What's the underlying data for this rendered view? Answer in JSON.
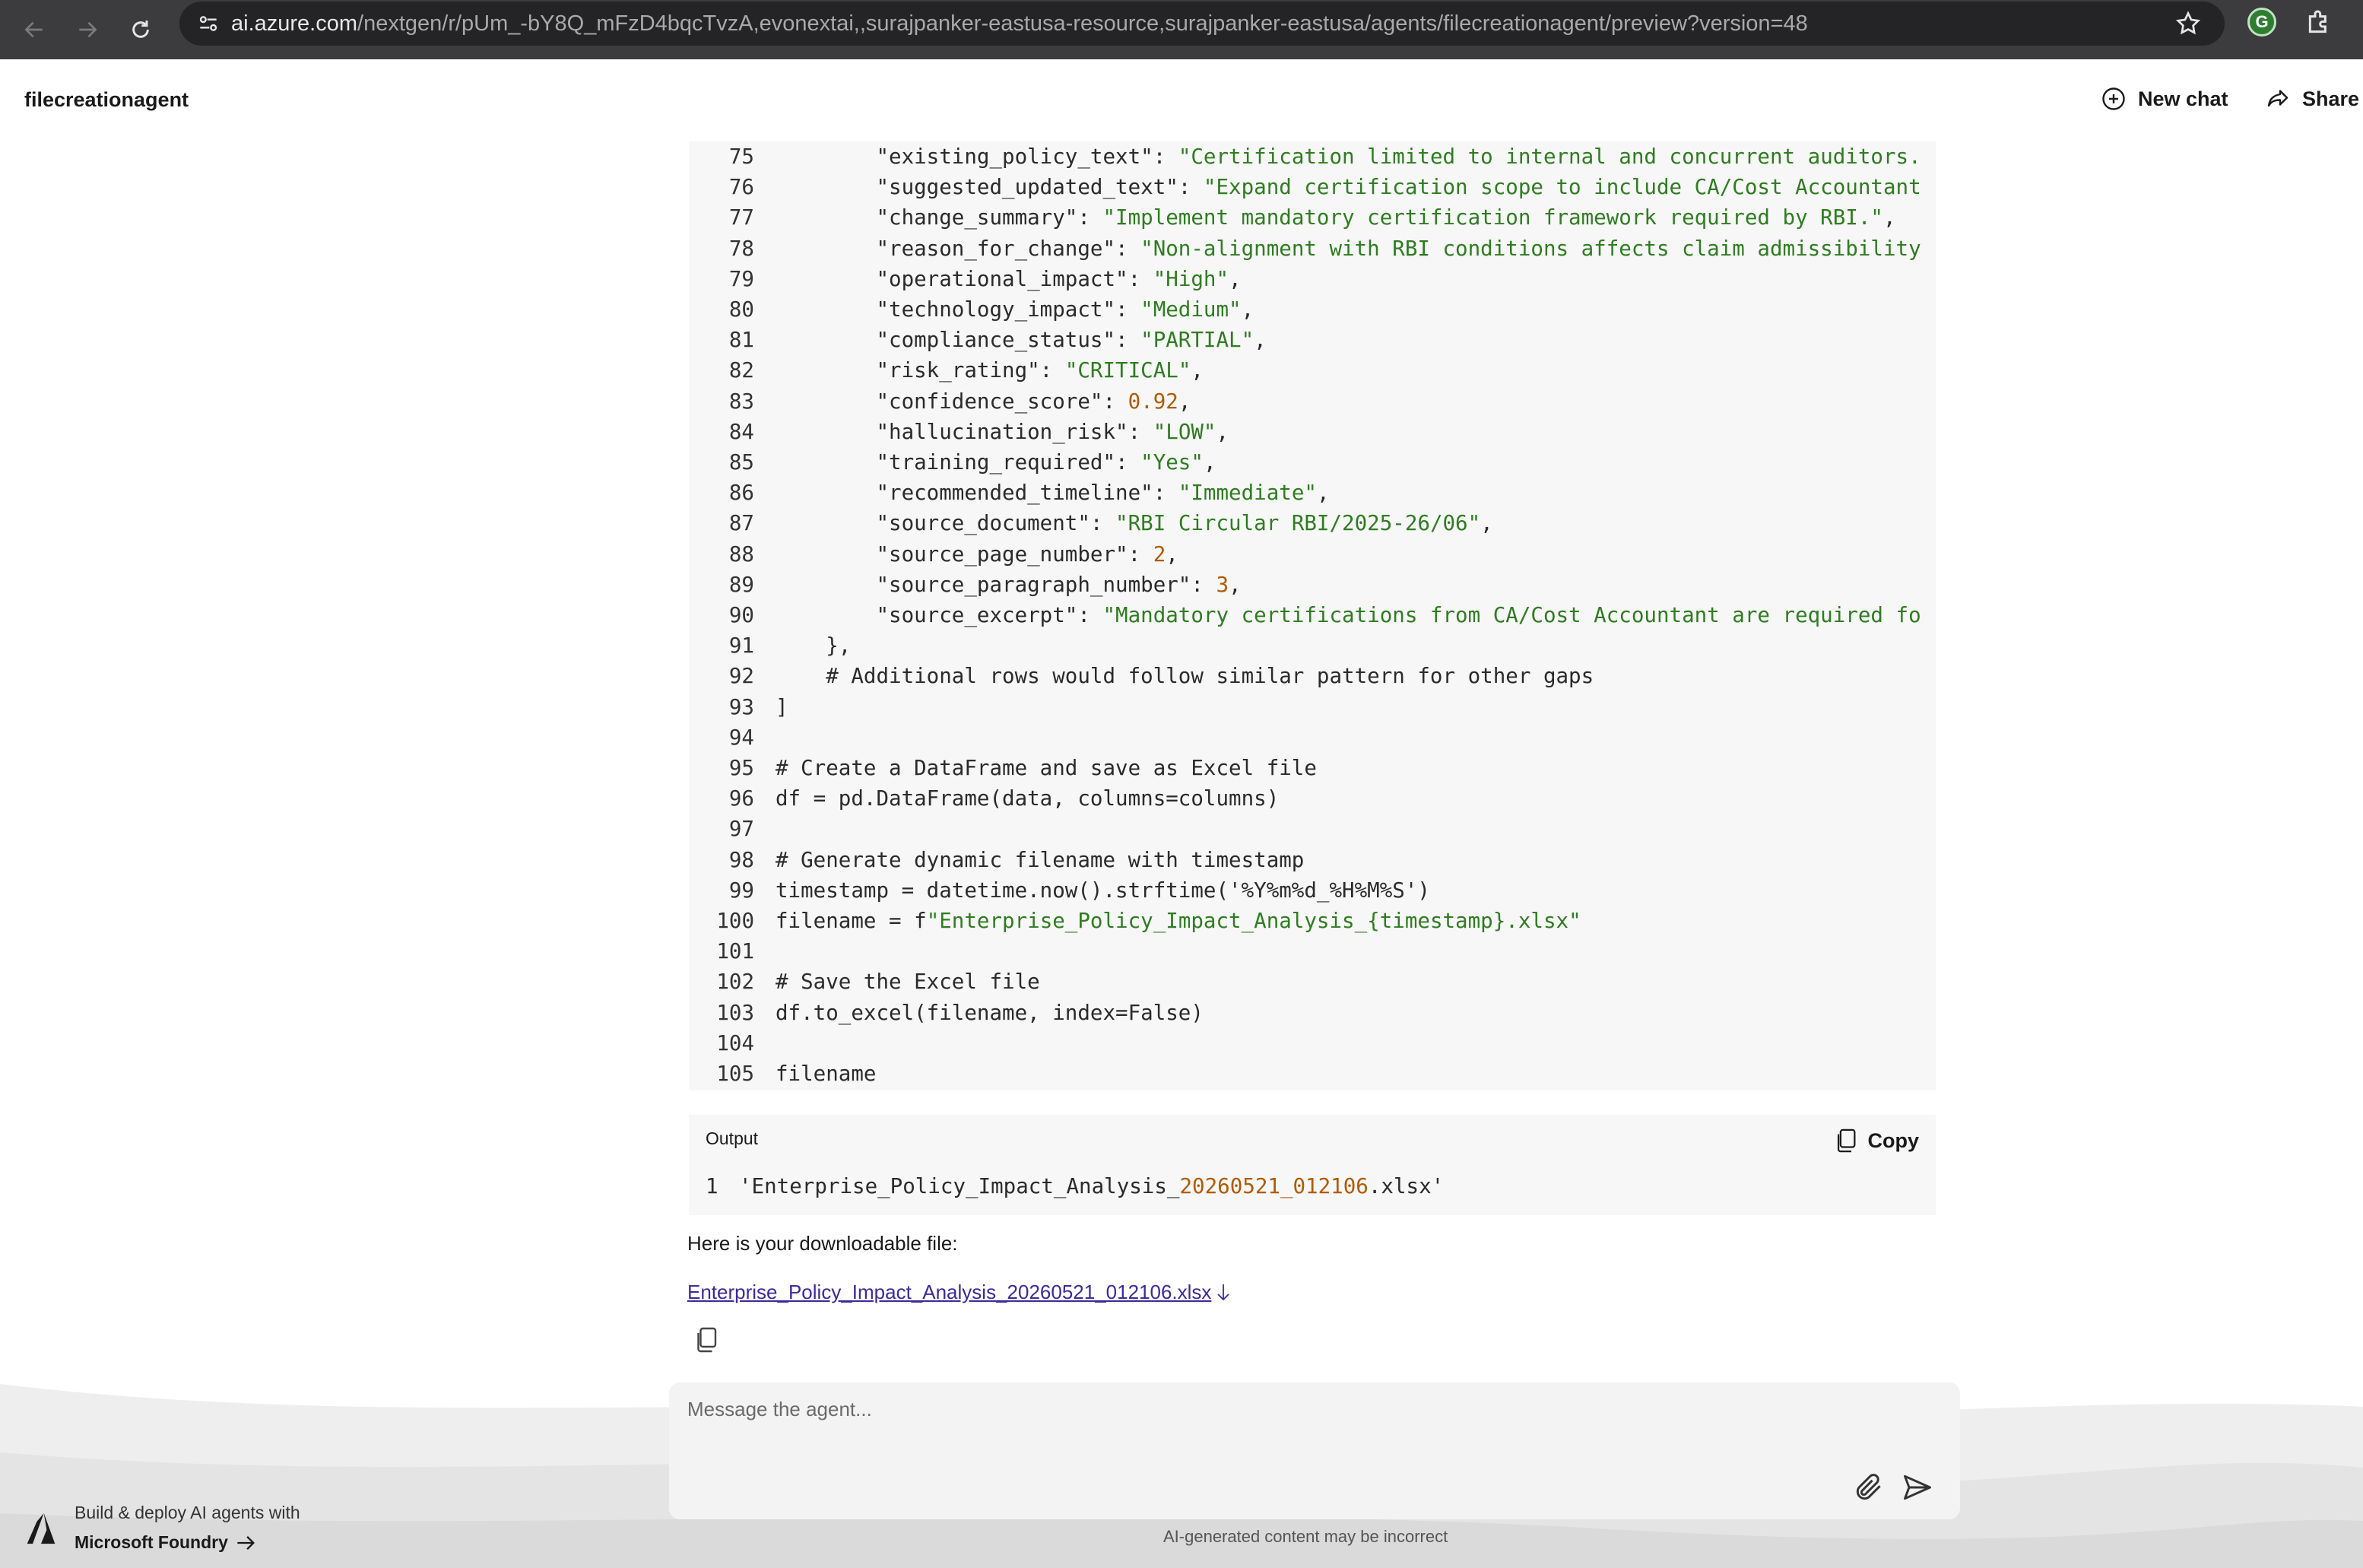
{
  "browser": {
    "url_domain": "ai.azure.com",
    "url_path": "/nextgen/r/pUm_-bY8Q_mFzD4bqcTvzA,evonextai,,surajpanker-eastusa-resource,surajpanker-eastusa/agents/filecreationagent/preview?version=48",
    "extension_letter": "G"
  },
  "header": {
    "agent_name": "filecreationagent",
    "new_chat_label": "New chat",
    "share_label": "Share"
  },
  "code": {
    "lines": [
      {
        "n": "75",
        "tokens": [
          {
            "t": "        \"existing_policy_text\": "
          },
          {
            "t": "\"Certification limited to internal and concurrent auditors.",
            "k": "s"
          }
        ]
      },
      {
        "n": "76",
        "tokens": [
          {
            "t": "        \"suggested_updated_text\": "
          },
          {
            "t": "\"Expand certification scope to include CA/Cost Accountant",
            "k": "s"
          }
        ]
      },
      {
        "n": "77",
        "tokens": [
          {
            "t": "        \"change_summary\": "
          },
          {
            "t": "\"Implement mandatory certification framework required by RBI.\"",
            "k": "s"
          },
          {
            "t": ","
          }
        ]
      },
      {
        "n": "78",
        "tokens": [
          {
            "t": "        \"reason_for_change\": "
          },
          {
            "t": "\"Non-alignment with RBI conditions affects claim admissibility",
            "k": "s"
          }
        ]
      },
      {
        "n": "79",
        "tokens": [
          {
            "t": "        \"operational_impact\": "
          },
          {
            "t": "\"High\"",
            "k": "s"
          },
          {
            "t": ","
          }
        ]
      },
      {
        "n": "80",
        "tokens": [
          {
            "t": "        \"technology_impact\": "
          },
          {
            "t": "\"Medium\"",
            "k": "s"
          },
          {
            "t": ","
          }
        ]
      },
      {
        "n": "81",
        "tokens": [
          {
            "t": "        \"compliance_status\": "
          },
          {
            "t": "\"PARTIAL\"",
            "k": "s"
          },
          {
            "t": ","
          }
        ]
      },
      {
        "n": "82",
        "tokens": [
          {
            "t": "        \"risk_rating\": "
          },
          {
            "t": "\"CRITICAL\"",
            "k": "s"
          },
          {
            "t": ","
          }
        ]
      },
      {
        "n": "83",
        "tokens": [
          {
            "t": "        \"confidence_score\": "
          },
          {
            "t": "0.92",
            "k": "n"
          },
          {
            "t": ","
          }
        ]
      },
      {
        "n": "84",
        "tokens": [
          {
            "t": "        \"hallucination_risk\": "
          },
          {
            "t": "\"LOW\"",
            "k": "s"
          },
          {
            "t": ","
          }
        ]
      },
      {
        "n": "85",
        "tokens": [
          {
            "t": "        \"training_required\": "
          },
          {
            "t": "\"Yes\"",
            "k": "s"
          },
          {
            "t": ","
          }
        ]
      },
      {
        "n": "86",
        "tokens": [
          {
            "t": "        \"recommended_timeline\": "
          },
          {
            "t": "\"Immediate\"",
            "k": "s"
          },
          {
            "t": ","
          }
        ]
      },
      {
        "n": "87",
        "tokens": [
          {
            "t": "        \"source_document\": "
          },
          {
            "t": "\"RBI Circular RBI/2025-26/06\"",
            "k": "s"
          },
          {
            "t": ","
          }
        ]
      },
      {
        "n": "88",
        "tokens": [
          {
            "t": "        \"source_page_number\": "
          },
          {
            "t": "2",
            "k": "n"
          },
          {
            "t": ","
          }
        ]
      },
      {
        "n": "89",
        "tokens": [
          {
            "t": "        \"source_paragraph_number\": "
          },
          {
            "t": "3",
            "k": "n"
          },
          {
            "t": ","
          }
        ]
      },
      {
        "n": "90",
        "tokens": [
          {
            "t": "        \"source_excerpt\": "
          },
          {
            "t": "\"Mandatory certifications from CA/Cost Accountant are required fo",
            "k": "s"
          }
        ]
      },
      {
        "n": "91",
        "tokens": [
          {
            "t": "    },"
          }
        ]
      },
      {
        "n": "92",
        "tokens": [
          {
            "t": "    # Additional rows would follow similar pattern for other gaps"
          }
        ]
      },
      {
        "n": "93",
        "tokens": [
          {
            "t": "]"
          }
        ]
      },
      {
        "n": "94",
        "tokens": [
          {
            "t": ""
          }
        ]
      },
      {
        "n": "95",
        "tokens": [
          {
            "t": "# Create a DataFrame and save as Excel file"
          }
        ]
      },
      {
        "n": "96",
        "tokens": [
          {
            "t": "df = pd.DataFrame(data, columns=columns)"
          }
        ]
      },
      {
        "n": "97",
        "tokens": [
          {
            "t": ""
          }
        ]
      },
      {
        "n": "98",
        "tokens": [
          {
            "t": "# Generate dynamic filename with timestamp"
          }
        ]
      },
      {
        "n": "99",
        "tokens": [
          {
            "t": "timestamp = datetime.now().strftime('%Y%m%d_%H%M%S')"
          }
        ]
      },
      {
        "n": "100",
        "tokens": [
          {
            "t": "filename = f"
          },
          {
            "t": "\"Enterprise_Policy_Impact_Analysis_{timestamp}.xlsx\"",
            "k": "s"
          }
        ]
      },
      {
        "n": "101",
        "tokens": [
          {
            "t": ""
          }
        ]
      },
      {
        "n": "102",
        "tokens": [
          {
            "t": "# Save the Excel file"
          }
        ]
      },
      {
        "n": "103",
        "tokens": [
          {
            "t": "df.to_excel(filename, index=False)"
          }
        ]
      },
      {
        "n": "104",
        "tokens": [
          {
            "t": ""
          }
        ]
      },
      {
        "n": "105",
        "tokens": [
          {
            "t": "filename"
          }
        ]
      }
    ]
  },
  "output": {
    "label": "Output",
    "copy_label": "Copy",
    "line_number": "1",
    "value_prefix": "'Enterprise_Policy_Impact_Analysis_",
    "value_num1": "20260521",
    "value_sep": "_",
    "value_num2": "012106",
    "value_suffix": ".xlsx'"
  },
  "message": {
    "intro": "Here is your downloadable file:",
    "file_link": "Enterprise_Policy_Impact_Analysis_20260521_012106.xlsx"
  },
  "composer": {
    "placeholder": "Message the agent...",
    "disclaimer": "AI-generated content may be incorrect"
  },
  "promo": {
    "line1": "Build & deploy AI agents with",
    "line2": "Microsoft Foundry"
  },
  "icons": {
    "back": "arrow-left-icon",
    "forward": "arrow-right-icon",
    "reload": "reload-icon",
    "site_info": "site-settings-icon",
    "bookmark": "star-icon",
    "extensions": "puzzle-icon",
    "new_chat": "plus-circle-icon",
    "share": "share-icon",
    "copy": "copy-icon",
    "download": "download-arrow-icon",
    "attach": "paperclip-icon",
    "send": "send-icon",
    "foundry": "foundry-logo-icon"
  },
  "colors": {
    "string": "#2f7d21",
    "number": "#b35a00",
    "link": "#3b2b9b",
    "browser_bar": "#3c3b3d"
  }
}
